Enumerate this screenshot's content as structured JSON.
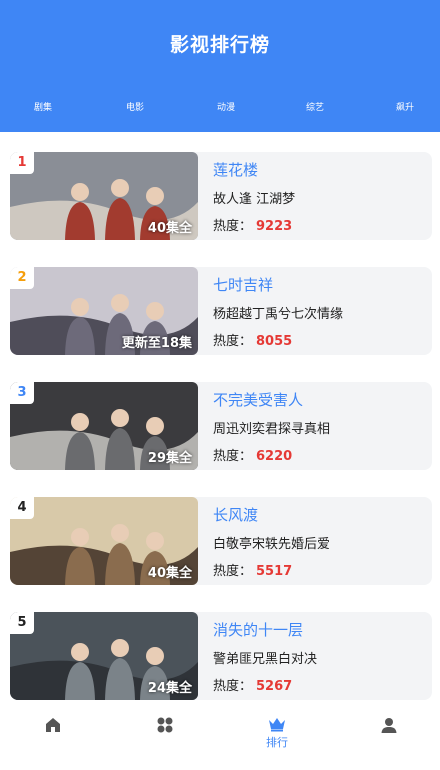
{
  "header": {
    "title": "影视排行榜",
    "tabs": [
      "剧集",
      "电影",
      "动漫",
      "综艺",
      "飙升"
    ]
  },
  "list": [
    {
      "rank": "1",
      "rank_color": "#e53935",
      "title": "莲花楼",
      "desc": "故人逢 江湖梦",
      "heat_label": "热度：",
      "heat": "9223",
      "episodes": "40集全",
      "colors": [
        "#8a8e96",
        "#a23b2f",
        "#d9d2c8"
      ]
    },
    {
      "rank": "2",
      "rank_color": "#f59e0b",
      "title": "七时吉祥",
      "desc": "杨超越丁禹兮七次情缘",
      "heat_label": "热度：",
      "heat": "8055",
      "episodes": "更新至18集",
      "colors": [
        "#c9c6cf",
        "#6d6a7a",
        "#3a3744"
      ]
    },
    {
      "rank": "3",
      "rank_color": "#3f86f5",
      "title": "不完美受害人",
      "desc": "周迅刘奕君探寻真相",
      "heat_label": "热度：",
      "heat": "6220",
      "episodes": "29集全",
      "colors": [
        "#3b3b3e",
        "#6a6b6e",
        "#c8c7c2"
      ]
    },
    {
      "rank": "4",
      "rank_color": "#222222",
      "title": "长风渡",
      "desc": "白敬亭宋轶先婚后爱",
      "heat_label": "热度：",
      "heat": "5517",
      "episodes": "40集全",
      "colors": [
        "#d8c9a9",
        "#8a6c4e",
        "#3d2d22"
      ]
    },
    {
      "rank": "5",
      "rank_color": "#222222",
      "title": "消失的十一层",
      "desc": "警弟匪兄黑白对决",
      "heat_label": "热度：",
      "heat": "5267",
      "episodes": "24集全",
      "colors": [
        "#4b535a",
        "#7b8389",
        "#2a2e33"
      ]
    }
  ],
  "nav": {
    "home_icon": "home-icon",
    "category_icon": "grid-icon",
    "rank_icon": "crown-icon",
    "rank_label": "排行",
    "profile_icon": "user-icon",
    "accent": "#3f86f5",
    "inactive": "#555555"
  }
}
